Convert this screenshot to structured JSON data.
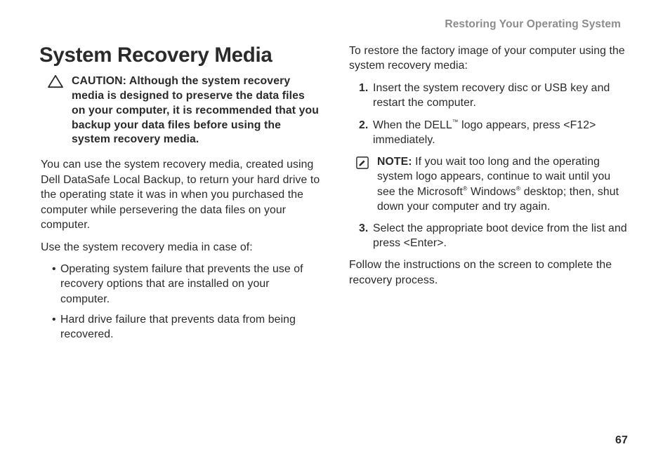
{
  "running_head": "Restoring Your Operating System",
  "page_number": "67",
  "left": {
    "title": "System Recovery Media",
    "caution": "CAUTION: Although the system recovery media is designed to preserve the data files on your computer, it is recommended that you backup your data files before using the system recovery media.",
    "para1": "You can use the system recovery media, created using Dell DataSafe Local Backup, to return your hard drive to the operating state it was in when you purchased the computer while persevering the data files on your computer.",
    "para2": "Use the system recovery media in case of:",
    "bullets": [
      "Operating system failure that prevents the use of recovery options that are installed on your computer.",
      "Hard drive failure that prevents data from being recovered."
    ]
  },
  "right": {
    "intro": "To restore the factory image of your computer using the system recovery media:",
    "steps": {
      "s1": "Insert the system recovery disc or USB key and restart the computer.",
      "s2_a": "When the DELL",
      "s2_tm": "™",
      "s2_b": " logo appears, press <F12> immediately.",
      "note_label": "NOTE:",
      "note_a": " If you wait too long and the operating system logo appears, continue to wait until you see the Microsoft",
      "note_reg1": "®",
      "note_b": " Windows",
      "note_reg2": "®",
      "note_c": " desktop; then, shut down your computer and try again.",
      "s3": "Select the appropriate boot device from the list and press <Enter>."
    },
    "outro": "Follow the instructions on the screen to complete the recovery process."
  }
}
